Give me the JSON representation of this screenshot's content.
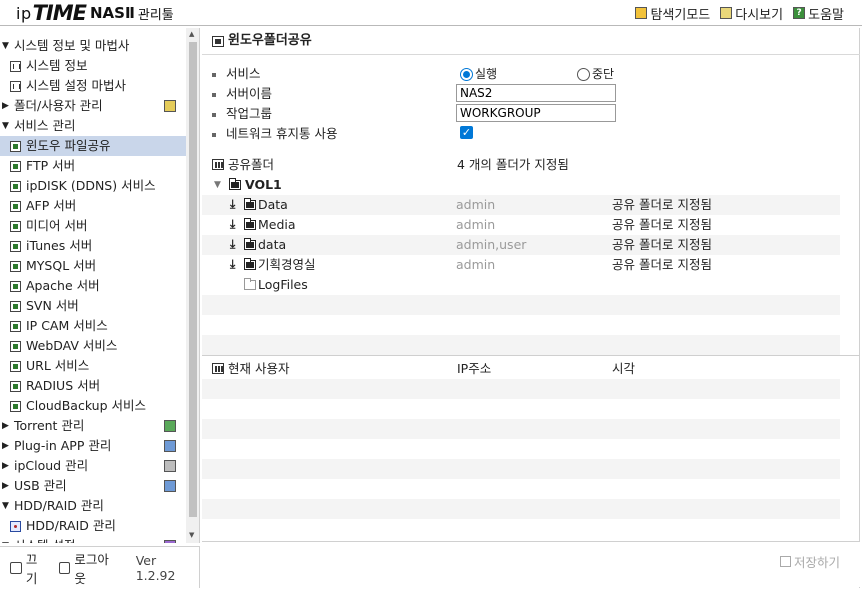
{
  "header": {
    "logo_ip": "ip",
    "logo_time": "TIME",
    "logo_nas": "NASⅡ",
    "logo_admin": "관리툴",
    "nav": [
      {
        "label": "탐색기모드",
        "icon": "explorer-mode-icon"
      },
      {
        "label": "다시보기",
        "icon": "reload-icon"
      },
      {
        "label": "도움말",
        "icon": "help-icon"
      }
    ]
  },
  "sidebar": {
    "items": [
      {
        "label": "시스템 정보 및 마법사",
        "kind": "group",
        "expanded": true
      },
      {
        "label": "시스템 정보",
        "kind": "child",
        "icon": "bars"
      },
      {
        "label": "시스템 설정 마법사",
        "kind": "child",
        "icon": "bars"
      },
      {
        "label": "폴더/사용자 관리",
        "kind": "group",
        "expanded": false,
        "badge": "gold"
      },
      {
        "label": "서비스 관리",
        "kind": "group",
        "expanded": true
      },
      {
        "label": "윈도우 파일공유",
        "kind": "child",
        "icon": "srv",
        "active": true
      },
      {
        "label": "FTP 서버",
        "kind": "child",
        "icon": "srv"
      },
      {
        "label": "ipDISK (DDNS) 서비스",
        "kind": "child",
        "icon": "srv"
      },
      {
        "label": "AFP 서버",
        "kind": "child",
        "icon": "srv"
      },
      {
        "label": "미디어 서버",
        "kind": "child",
        "icon": "srv"
      },
      {
        "label": "iTunes 서버",
        "kind": "child",
        "icon": "srv"
      },
      {
        "label": "MYSQL 서버",
        "kind": "child",
        "icon": "srv"
      },
      {
        "label": "Apache 서버",
        "kind": "child",
        "icon": "srv"
      },
      {
        "label": "SVN 서버",
        "kind": "child",
        "icon": "srv"
      },
      {
        "label": "IP CAM 서비스",
        "kind": "child",
        "icon": "srv"
      },
      {
        "label": "WebDAV 서비스",
        "kind": "child",
        "icon": "srv"
      },
      {
        "label": "URL 서비스",
        "kind": "child",
        "icon": "srv"
      },
      {
        "label": "RADIUS 서버",
        "kind": "child",
        "icon": "srv"
      },
      {
        "label": "CloudBackup 서비스",
        "kind": "child",
        "icon": "srv"
      },
      {
        "label": "Torrent 관리",
        "kind": "group",
        "expanded": false,
        "badge": "green"
      },
      {
        "label": "Plug-in APP 관리",
        "kind": "group",
        "expanded": false,
        "badge": "blue"
      },
      {
        "label": "ipCloud 관리",
        "kind": "group",
        "expanded": false,
        "badge": "gray"
      },
      {
        "label": "USB 관리",
        "kind": "group",
        "expanded": false,
        "badge": "blue"
      },
      {
        "label": "HDD/RAID 관리",
        "kind": "group",
        "expanded": true
      },
      {
        "label": "HDD/RAID 관리",
        "kind": "child",
        "icon": "disk"
      },
      {
        "label": "시스템 설정",
        "kind": "group",
        "expanded": true,
        "badge": "purple"
      }
    ],
    "footer": {
      "off_label": "끄기",
      "logout_label": "로그아웃",
      "version": "Ver 1.2.92"
    }
  },
  "main": {
    "title": "윈도우폴더공유",
    "form": {
      "service_label": "서비스",
      "run_label": "실행",
      "stop_label": "중단",
      "service_value": "실행",
      "server_name_label": "서버이름",
      "server_name_value": "NAS2",
      "workgroup_label": "작업그룹",
      "workgroup_value": "WORKGROUP",
      "recycle_label": "네트워크 휴지통 사용",
      "recycle_checked": true
    },
    "shared": {
      "header_label": "공유폴더",
      "count_text": "4 개의 폴더가 지정됨",
      "volume": "VOL1",
      "folders": [
        {
          "name": "Data",
          "users": "admin",
          "status": "공유 폴더로 지정됨"
        },
        {
          "name": "Media",
          "users": "admin",
          "status": "공유 폴더로 지정됨"
        },
        {
          "name": "data",
          "users": "admin,user",
          "status": "공유 폴더로 지정됨"
        },
        {
          "name": "기획경영실",
          "users": "admin",
          "status": "공유 폴더로 지정됨"
        }
      ],
      "other_folder": "LogFiles"
    },
    "current_users": {
      "header_label": "현재 사용자",
      "col_ip": "IP주소",
      "col_time": "시각"
    },
    "save_label": "저장하기"
  }
}
